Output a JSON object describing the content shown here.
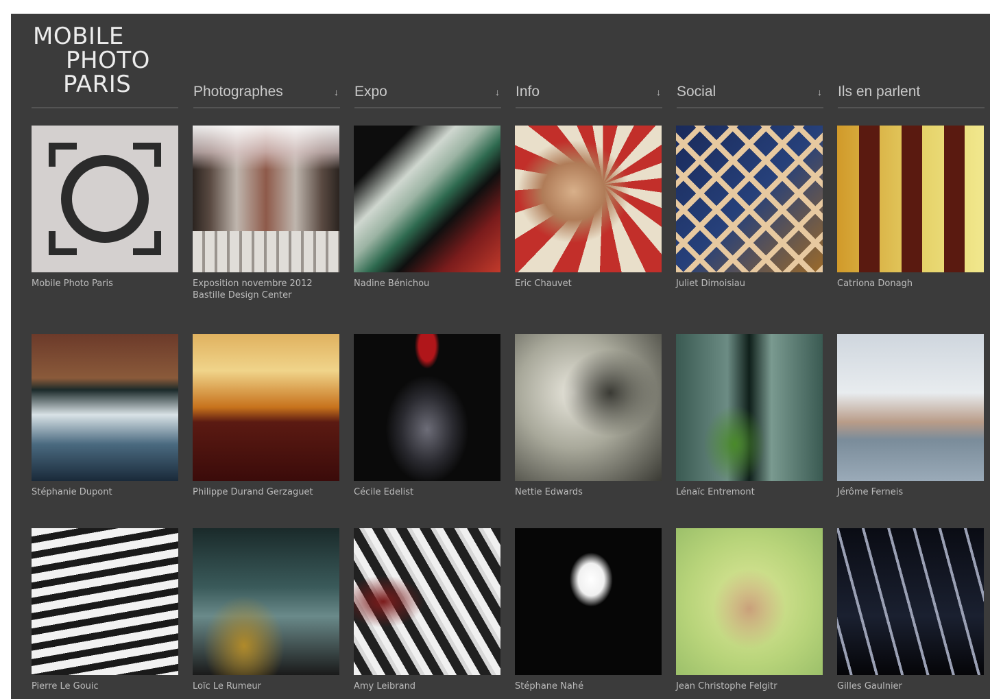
{
  "site": {
    "logo_lines": [
      "MOBILE",
      "PHOTO",
      "PARIS"
    ]
  },
  "nav": [
    {
      "label": "Photographes",
      "arrow": "↓"
    },
    {
      "label": "Expo",
      "arrow": "↓"
    },
    {
      "label": "Info",
      "arrow": "↓"
    },
    {
      "label": "Social",
      "arrow": "↓"
    },
    {
      "label": "Ils en parlent",
      "arrow": ""
    }
  ],
  "grid": [
    {
      "caption": "Mobile Photo Paris",
      "caption2": ""
    },
    {
      "caption": "Exposition novembre 2012",
      "caption2": "Bastille Design Center"
    },
    {
      "caption": "Nadine Bénichou",
      "caption2": ""
    },
    {
      "caption": "Eric Chauvet",
      "caption2": ""
    },
    {
      "caption": "Juliet Dimoisiau",
      "caption2": ""
    },
    {
      "caption": "Catriona Donagh",
      "caption2": ""
    },
    {
      "caption": "Stéphanie Dupont",
      "caption2": ""
    },
    {
      "caption": "Philippe Durand Gerzaguet",
      "caption2": ""
    },
    {
      "caption": "Cécile Edelist",
      "caption2": ""
    },
    {
      "caption": "Nettie Edwards",
      "caption2": ""
    },
    {
      "caption": "Lénaïc Entremont",
      "caption2": ""
    },
    {
      "caption": "Jérôme Ferneis",
      "caption2": ""
    },
    {
      "caption": "Pierre Le Gouic",
      "caption2": ""
    },
    {
      "caption": "Loïc Le Rumeur",
      "caption2": ""
    },
    {
      "caption": "Amy Leibrand",
      "caption2": ""
    },
    {
      "caption": "Stéphane Nahé",
      "caption2": ""
    },
    {
      "caption": "Jean Christophe Felgitr",
      "caption2": ""
    },
    {
      "caption": "Gilles Gaulnier",
      "caption2": ""
    }
  ]
}
